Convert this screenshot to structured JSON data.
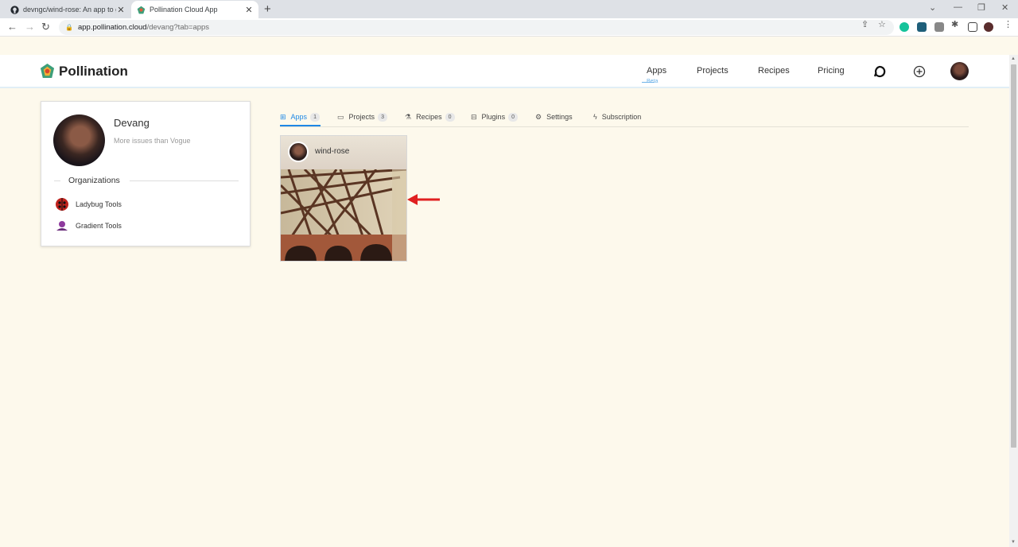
{
  "browser": {
    "tabs": [
      {
        "title": "devngc/wind-rose: An app to ge",
        "icon": "github-icon",
        "active": false
      },
      {
        "title": "Pollination Cloud App",
        "icon": "pollination-icon",
        "active": true
      }
    ],
    "new_tab_glyph": "+",
    "url_host": "app.pollination.cloud",
    "url_path": "/devang?tab=apps"
  },
  "header": {
    "brand": "Pollination",
    "nav": [
      "Apps",
      "Projects",
      "Recipes",
      "Pricing"
    ],
    "active_nav": "Apps",
    "beta_label": "Beta",
    "icons": [
      "discourse-icon",
      "add-circle-icon",
      "user-avatar"
    ]
  },
  "profile": {
    "name": "Devang",
    "bio": "More issues than Vogue",
    "organizations_heading": "Organizations",
    "organizations": [
      {
        "name": "Ladybug Tools",
        "icon": "ladybug-icon"
      },
      {
        "name": "Gradient Tools",
        "icon": "gradient-tools-icon"
      }
    ]
  },
  "tabs": [
    {
      "label": "Apps",
      "count": "1",
      "icon": "apps-icon",
      "active": true
    },
    {
      "label": "Projects",
      "count": "3",
      "icon": "folder-icon",
      "active": false
    },
    {
      "label": "Recipes",
      "count": "0",
      "icon": "recipe-icon",
      "active": false
    },
    {
      "label": "Plugins",
      "count": "0",
      "icon": "plugin-icon",
      "active": false
    },
    {
      "label": "Settings",
      "icon": "gear-icon",
      "active": false
    },
    {
      "label": "Subscription",
      "icon": "bolt-icon",
      "active": false
    }
  ],
  "apps": [
    {
      "name": "wind-rose"
    }
  ],
  "colors": {
    "page_bg": "#fdf9ec",
    "accent": "#1e88e5",
    "annotation_arrow": "#e02020"
  }
}
